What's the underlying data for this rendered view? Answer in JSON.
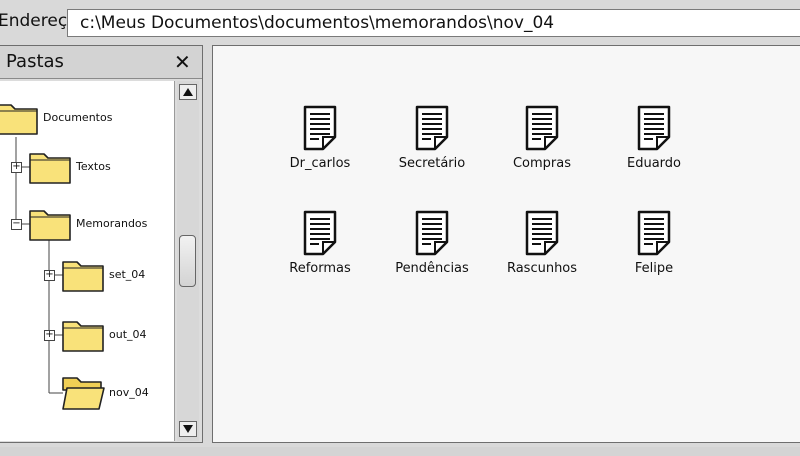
{
  "address": {
    "label": "Endereço",
    "value": "c:\\Meus Documentos\\documentos\\memorandos\\nov_04"
  },
  "folder_pane": {
    "title": "Pastas",
    "close_symbol": "✕",
    "nodes": [
      {
        "label": "Documentos",
        "icon": "folder-icon"
      },
      {
        "label": "Textos",
        "icon": "folder-icon",
        "toggle": "+"
      },
      {
        "label": "Memorandos",
        "icon": "folder-icon",
        "toggle": "−"
      },
      {
        "label": "set_04",
        "icon": "folder-icon",
        "toggle": "+"
      },
      {
        "label": "out_04",
        "icon": "folder-icon",
        "toggle": "+"
      },
      {
        "label": "nov_04",
        "icon": "open-folder-icon"
      }
    ]
  },
  "files": [
    {
      "label": "Dr_carlos",
      "icon": "document-icon"
    },
    {
      "label": "Secretário",
      "icon": "document-icon"
    },
    {
      "label": "Compras",
      "icon": "document-icon"
    },
    {
      "label": "Eduardo",
      "icon": "document-icon"
    },
    {
      "label": "Reformas",
      "icon": "document-icon"
    },
    {
      "label": "Pendências",
      "icon": "document-icon"
    },
    {
      "label": "Rascunhos",
      "icon": "document-icon"
    },
    {
      "label": "Felipe",
      "icon": "document-icon"
    }
  ],
  "colors": {
    "folder_fill": "#f9e27a",
    "folder_stroke": "#222222",
    "document_stroke": "#111111"
  }
}
